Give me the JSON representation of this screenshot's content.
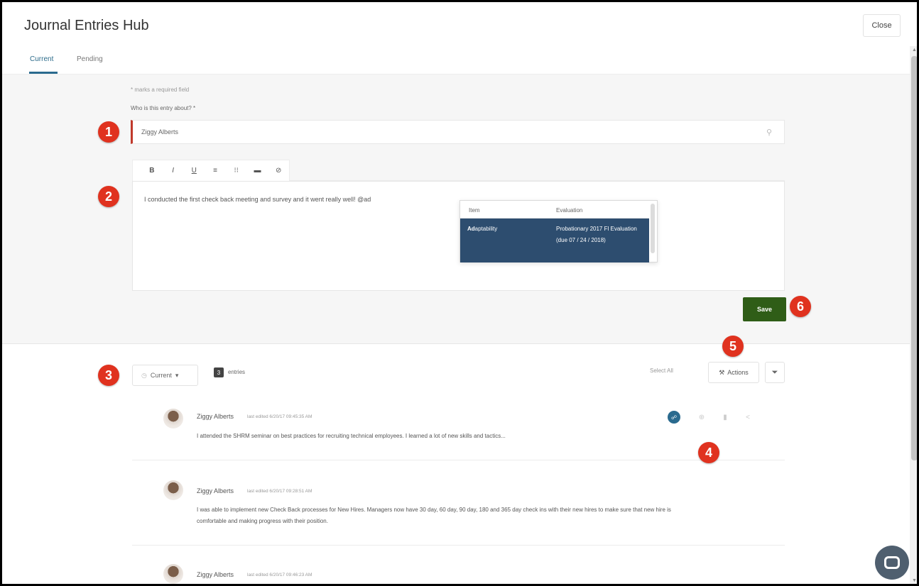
{
  "header": {
    "title": "Journal Entries Hub",
    "close_label": "Close"
  },
  "tabs": [
    {
      "label": "Current"
    },
    {
      "label": "Pending"
    }
  ],
  "form": {
    "required_note": "* marks a required field",
    "who_label": "Who is this entry about? *",
    "who_value": "Ziggy Alberts",
    "toolbar": [
      "B",
      "I",
      "U",
      "≡",
      "⁝⁝",
      "▬",
      "⊘"
    ],
    "editor_text": "I conducted the first check back meeting and survey and it went really well! @ad",
    "suggestions": {
      "col_item": "Item",
      "col_evaluation": "Evaluation",
      "row_item_bold": "Ad",
      "row_item_rest": "aptability",
      "row_evaluation": "Probationary 2017 Fl Evaluation (due 07 / 24 / 2018)"
    },
    "save_label": "Save"
  },
  "list": {
    "filter_label": "Current",
    "entry_count": "3",
    "entries_label": "entries",
    "select_all": "Select All",
    "actions_label": "Actions",
    "entries": [
      {
        "author": "Ziggy Alberts",
        "edited": "last edited 6/20/17 09:45:35 AM",
        "body": "I attended the SHRM seminar on best practices for recruiting technical employees. I learned a lot of new skills and tactics..."
      },
      {
        "author": "Ziggy Alberts",
        "edited": "last edited 6/20/17 09:28:51 AM",
        "body": "I was able to implement new Check Back processes for New Hires. Managers now have 30 day, 60 day, 90 day, 180 and 365 day check ins with their new hires to make sure that new hire is comfortable and making progress with their position."
      },
      {
        "author": "Ziggy Alberts",
        "edited": "last edited 6/20/17 09:46:23 AM",
        "body": ""
      }
    ]
  },
  "markers": [
    "1",
    "2",
    "3",
    "4",
    "5",
    "6"
  ],
  "colors": {
    "accent_blue": "#2a6a8e",
    "save_green": "#2f5d17",
    "marker_red": "#e0321f",
    "suggest_bg": "#2d4d6f"
  }
}
